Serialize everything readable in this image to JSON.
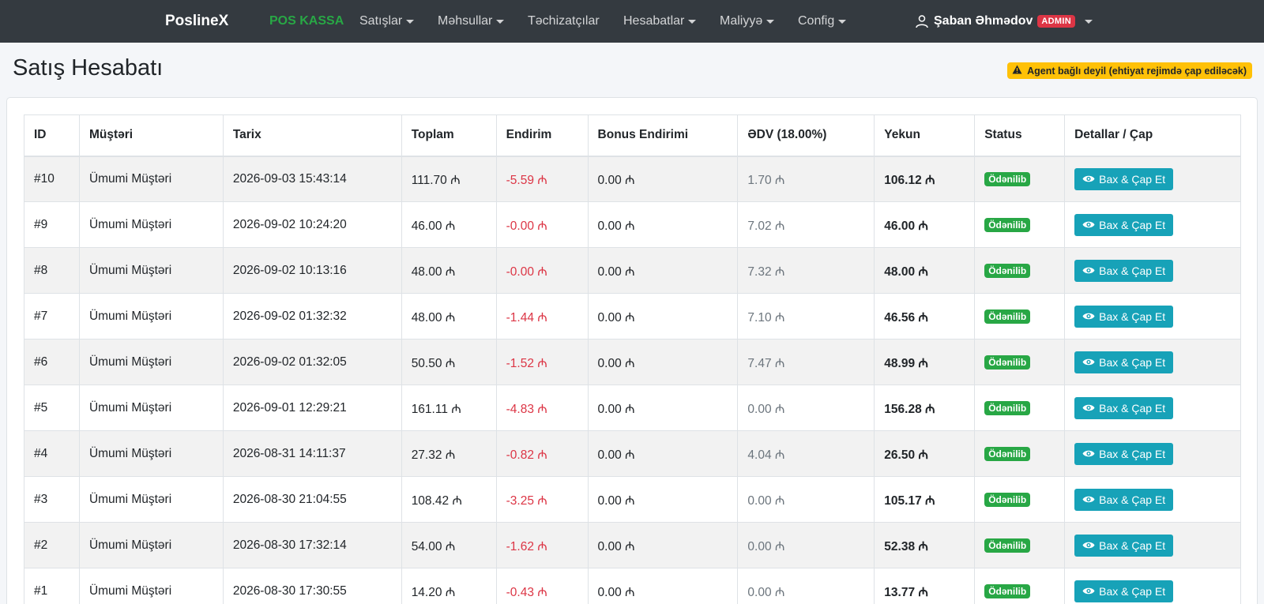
{
  "nav": {
    "brand": "PoslineX",
    "items": [
      {
        "label": "POS KASSA",
        "active": true,
        "dropdown": false
      },
      {
        "label": "Satışlar",
        "active": false,
        "dropdown": true
      },
      {
        "label": "Məhsullar",
        "active": false,
        "dropdown": true
      },
      {
        "label": "Təchizatçılar",
        "active": false,
        "dropdown": false
      },
      {
        "label": "Hesabatlar",
        "active": false,
        "dropdown": true
      },
      {
        "label": "Maliyyə",
        "active": false,
        "dropdown": true
      },
      {
        "label": "Config",
        "active": false,
        "dropdown": true
      }
    ],
    "user": {
      "name": "Şaban Əhmədov",
      "role": "ADMIN",
      "icon": "user-icon"
    }
  },
  "page": {
    "title": "Satış Hesabatı",
    "agent_warning": "Agent bağlı deyil (ehtiyat rejimdə çap ediləcək)",
    "warning_icon": "warning-icon"
  },
  "table": {
    "headers": [
      "ID",
      "Müştəri",
      "Tarix",
      "Toplam",
      "Endirim",
      "Bonus Endirimi",
      "ƏDV (18.00%)",
      "Yekun",
      "Status",
      "Detallar / Çap"
    ],
    "action_label": "Bax & Çap Et",
    "rows": [
      {
        "id": "#10",
        "customer": "Ümumi Müştəri",
        "date": "2026-09-03 15:43:14",
        "total": "111.70 ₼",
        "discount": "-5.59 ₼",
        "bonus": "0.00 ₼",
        "vat": "1.70 ₼",
        "final": "106.12 ₼",
        "status": "Ödənilib"
      },
      {
        "id": "#9",
        "customer": "Ümumi Müştəri",
        "date": "2026-09-02 10:24:20",
        "total": "46.00 ₼",
        "discount": "-0.00 ₼",
        "bonus": "0.00 ₼",
        "vat": "7.02 ₼",
        "final": "46.00 ₼",
        "status": "Ödənilib"
      },
      {
        "id": "#8",
        "customer": "Ümumi Müştəri",
        "date": "2026-09-02 10:13:16",
        "total": "48.00 ₼",
        "discount": "-0.00 ₼",
        "bonus": "0.00 ₼",
        "vat": "7.32 ₼",
        "final": "48.00 ₼",
        "status": "Ödənilib"
      },
      {
        "id": "#7",
        "customer": "Ümumi Müştəri",
        "date": "2026-09-02 01:32:32",
        "total": "48.00 ₼",
        "discount": "-1.44 ₼",
        "bonus": "0.00 ₼",
        "vat": "7.10 ₼",
        "final": "46.56 ₼",
        "status": "Ödənilib"
      },
      {
        "id": "#6",
        "customer": "Ümumi Müştəri",
        "date": "2026-09-02 01:32:05",
        "total": "50.50 ₼",
        "discount": "-1.52 ₼",
        "bonus": "0.00 ₼",
        "vat": "7.47 ₼",
        "final": "48.99 ₼",
        "status": "Ödənilib"
      },
      {
        "id": "#5",
        "customer": "Ümumi Müştəri",
        "date": "2026-09-01 12:29:21",
        "total": "161.11 ₼",
        "discount": "-4.83 ₼",
        "bonus": "0.00 ₼",
        "vat": "0.00 ₼",
        "final": "156.28 ₼",
        "status": "Ödənilib"
      },
      {
        "id": "#4",
        "customer": "Ümumi Müştəri",
        "date": "2026-08-31 14:11:37",
        "total": "27.32 ₼",
        "discount": "-0.82 ₼",
        "bonus": "0.00 ₼",
        "vat": "4.04 ₼",
        "final": "26.50 ₼",
        "status": "Ödənilib"
      },
      {
        "id": "#3",
        "customer": "Ümumi Müştəri",
        "date": "2026-08-30 21:04:55",
        "total": "108.42 ₼",
        "discount": "-3.25 ₼",
        "bonus": "0.00 ₼",
        "vat": "0.00 ₼",
        "final": "105.17 ₼",
        "status": "Ödənilib"
      },
      {
        "id": "#2",
        "customer": "Ümumi Müştəri",
        "date": "2026-08-30 17:32:14",
        "total": "54.00 ₼",
        "discount": "-1.62 ₼",
        "bonus": "0.00 ₼",
        "vat": "0.00 ₼",
        "final": "52.38 ₼",
        "status": "Ödənilib"
      },
      {
        "id": "#1",
        "customer": "Ümumi Müştəri",
        "date": "2026-08-30 17:30:55",
        "total": "14.20 ₼",
        "discount": "-0.43 ₼",
        "bonus": "0.00 ₼",
        "vat": "0.00 ₼",
        "final": "13.77 ₼",
        "status": "Ödənilib"
      }
    ]
  },
  "colors": {
    "navbar": "#343a40",
    "active_nav": "#28a745",
    "admin_badge": "#dc3545",
    "warning": "#ffc107",
    "discount": "#dc3545",
    "status_paid": "#28a745",
    "action_button": "#17a2b8"
  }
}
